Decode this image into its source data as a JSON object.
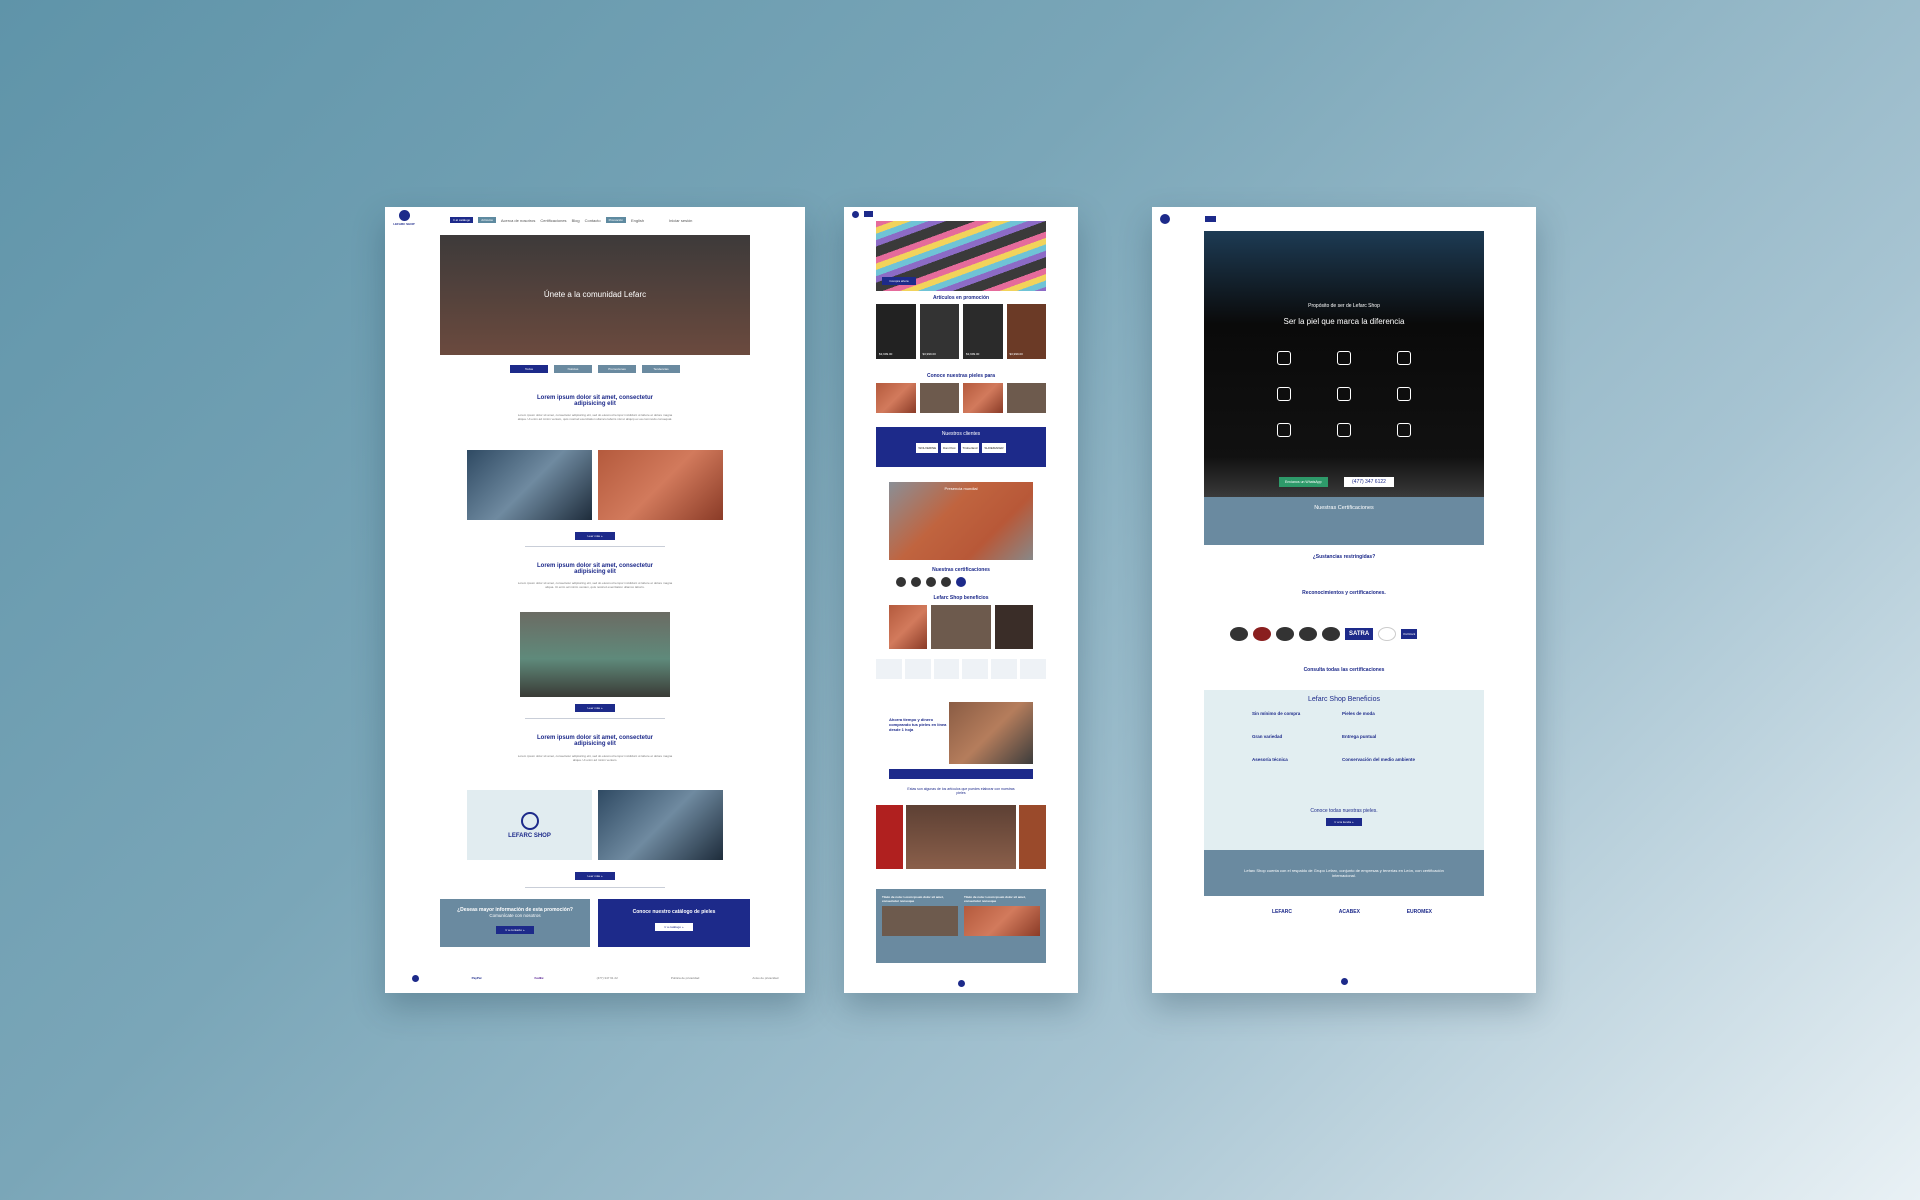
{
  "left_page": {
    "nav": {
      "logo": "LEFARC SHOP",
      "catalog_btn": "Ir al catálogo",
      "links": [
        "Artículos",
        "Acerca de nosotros",
        "Certificaciones",
        "Blog",
        "Contacto"
      ],
      "active": "Artículos",
      "promo": "Promoción",
      "lang": "English",
      "account": "Iniciar sesión"
    },
    "hero_title": "Únete a la comunidad Lefarc",
    "tabs": [
      "Todos",
      "Noticias",
      "Promociones",
      "Tendencias"
    ],
    "posts": [
      {
        "title": "Lorem ipsum dolor sit amet, consectetur adipisicing elit",
        "body": "Lorem ipsum dolor sit amet, consectetur adipisicing elit, sed do eiusmod tempor incididunt ut labore et dolore magna aliqua. Ut enim ad minim veniam, quis nostrud exercitation ullamco laboris nisi ut aliquip ex ea commodo consequat.",
        "cta": "Leer más »"
      },
      {
        "title": "Lorem ipsum dolor sit amet, consectetur adipisicing elit",
        "body": "Lorem ipsum dolor sit amet, consectetur adipisicing elit, sed do eiusmod tempor incididunt ut labore et dolore magna aliqua. Ut enim ad minim veniam, quis nostrud exercitation ullamco laboris.",
        "cta": "Leer más »"
      },
      {
        "title": "Lorem ipsum dolor sit amet, consectetur adipisicing elit",
        "body": "Lorem ipsum dolor sit amet, consectetur adipisicing elit, sed do eiusmod tempor incididunt ut labore et dolore magna aliqua. Ut enim ad minim veniam.",
        "cta": "Leer más »"
      }
    ],
    "brand_tile": "LEFARC SHOP",
    "info_box": {
      "title": "¿Deseas mayor información de esta promoción?",
      "sub": "Comunícate con nosotros",
      "cta": "Ir a contacto »"
    },
    "catalog_box": {
      "title": "Conoce nuestro catálogo de pieles",
      "cta": "Ir a catálogo »"
    },
    "footer": {
      "paypal": "PayPal",
      "fedex": "FedEx",
      "phone": "(477) 347 61 22",
      "privacy": "Política de privacidad",
      "terms": "Aviso de privacidad"
    }
  },
  "middle_page": {
    "hero_text": "Compra ahora",
    "promo_title": "Artículos en promoción",
    "prices": [
      "$3,999.00",
      "$3,999.00",
      "$3,999.00",
      "$3,999.00"
    ],
    "skins_title": "Conoce nuestras pieles para",
    "clients_title": "Nuestros clientes",
    "clients": [
      "WOLVERINE",
      "Dan Post",
      "Timberland",
      "SHOEMAKER"
    ],
    "map_title": "Presencia mundial",
    "certs_title": "Nuestras certificaciones",
    "benefits_title": "Lefarc Shop beneficios",
    "paypal_title": "Ahorra tiempo y dinero comprando tus pieles en línea desde 1 hoja",
    "experience_title": "Estas son algunas de los artículos que puedes elaborar con nuestras pieles",
    "blog_cards": [
      "Título de nota: Lorem ipsum dolor sit amet, consectetur nonsoque",
      "Título de nota: Lorem ipsum dolor sit amet, consectetur nonsoque"
    ]
  },
  "right_page": {
    "hero_small": "Propósito de ser de Lefarc Shop",
    "hero_title": "Ser la piel que marca la diferencia",
    "whatsapp": "Envíanos un WhatsApp",
    "phone": "(477) 347 6122",
    "certs_section": "Nuestras Certificaciones",
    "restricted": "¿Sustancias restringidas?",
    "recognitions": "Reconocimientos y certificaciones.",
    "cert_logos": [
      "SATRA",
      "Kid Rock"
    ],
    "see_all": "Consulta todas las certificaciones",
    "benefits_title": "Lefarc Shop Beneficios",
    "benefits": [
      "Sin mínimo de compra",
      "Pieles de moda",
      "Gran variedad",
      "Entrega puntual",
      "Asesoría técnica",
      "Conservación del medio ambiente"
    ],
    "skins_cta": "Conoce todas nuestras pieles.",
    "store_btn": "Ir a la tienda »",
    "group_text": "Lefarc Shop cuenta con el respaldo de Grupo Lefarc, conjunto de empresas y tenerías en León, con certificación internacional.",
    "companies": [
      "LEFARC",
      "ACABEX",
      "EUROMEX"
    ]
  }
}
